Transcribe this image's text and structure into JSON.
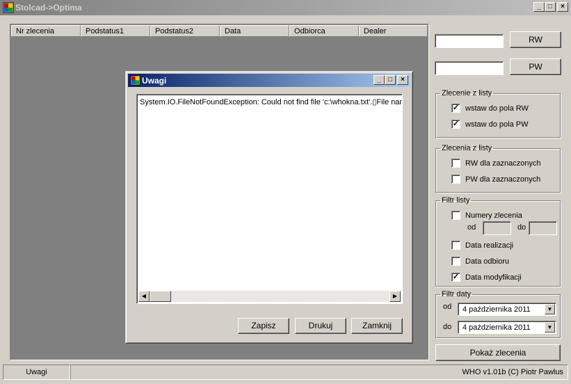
{
  "window": {
    "title": "Stolcad->Optima",
    "minimize": "_",
    "maximize": "□",
    "close": "×"
  },
  "list": {
    "columns": [
      "Nr zlecenia",
      "Podstatus1",
      "Podstatus2",
      "Data",
      "Odbiorca",
      "Dealer"
    ]
  },
  "right": {
    "rw_input": "",
    "rw_button": "RW",
    "pw_input": "",
    "pw_button": "PW",
    "group1": {
      "legend": "Zlecenie z listy",
      "opt1": "wstaw do pola RW",
      "opt1_checked": true,
      "opt2": "wstaw do pola PW",
      "opt2_checked": true
    },
    "group2": {
      "legend": "Zlecenia z listy",
      "opt1": "RW dla zaznaczonych",
      "opt1_checked": false,
      "opt2": "PW dla zaznaczonych",
      "opt2_checked": false
    },
    "group3": {
      "legend": "Filtr listy",
      "numery": "Numery zlecenia",
      "numery_checked": false,
      "od": "od",
      "do": "do",
      "realizacji": "Data realizacji",
      "realizacji_checked": false,
      "odbioru": "Data odbioru",
      "odbioru_checked": false,
      "modyfikacji": "Data modyfikacji",
      "modyfikacji_checked": true
    },
    "group4": {
      "legend": "Filtr daty",
      "od": "od",
      "od_value": "4 października 2011",
      "do": "do",
      "do_value": "4 października 2011"
    },
    "show_button": "Pokaż zlecenia"
  },
  "status": {
    "left": "Uwagi",
    "right": "WHO v1.01b (C) Piotr Pawlus"
  },
  "dialog": {
    "title": "Uwagi",
    "minimize": "_",
    "maximize": "□",
    "close": "×",
    "text": "System.IO.FileNotFoundException: Could not find file 'c:\\whokna.txt'.▯File name:",
    "save": "Zapisz",
    "print": "Drukuj",
    "close_button": "Zamknij"
  },
  "colors": {
    "title_gradient_start": "#0a246a",
    "title_gradient_end": "#a6caf0",
    "inactive_title": "#808080",
    "face": "#d4d0c8"
  }
}
